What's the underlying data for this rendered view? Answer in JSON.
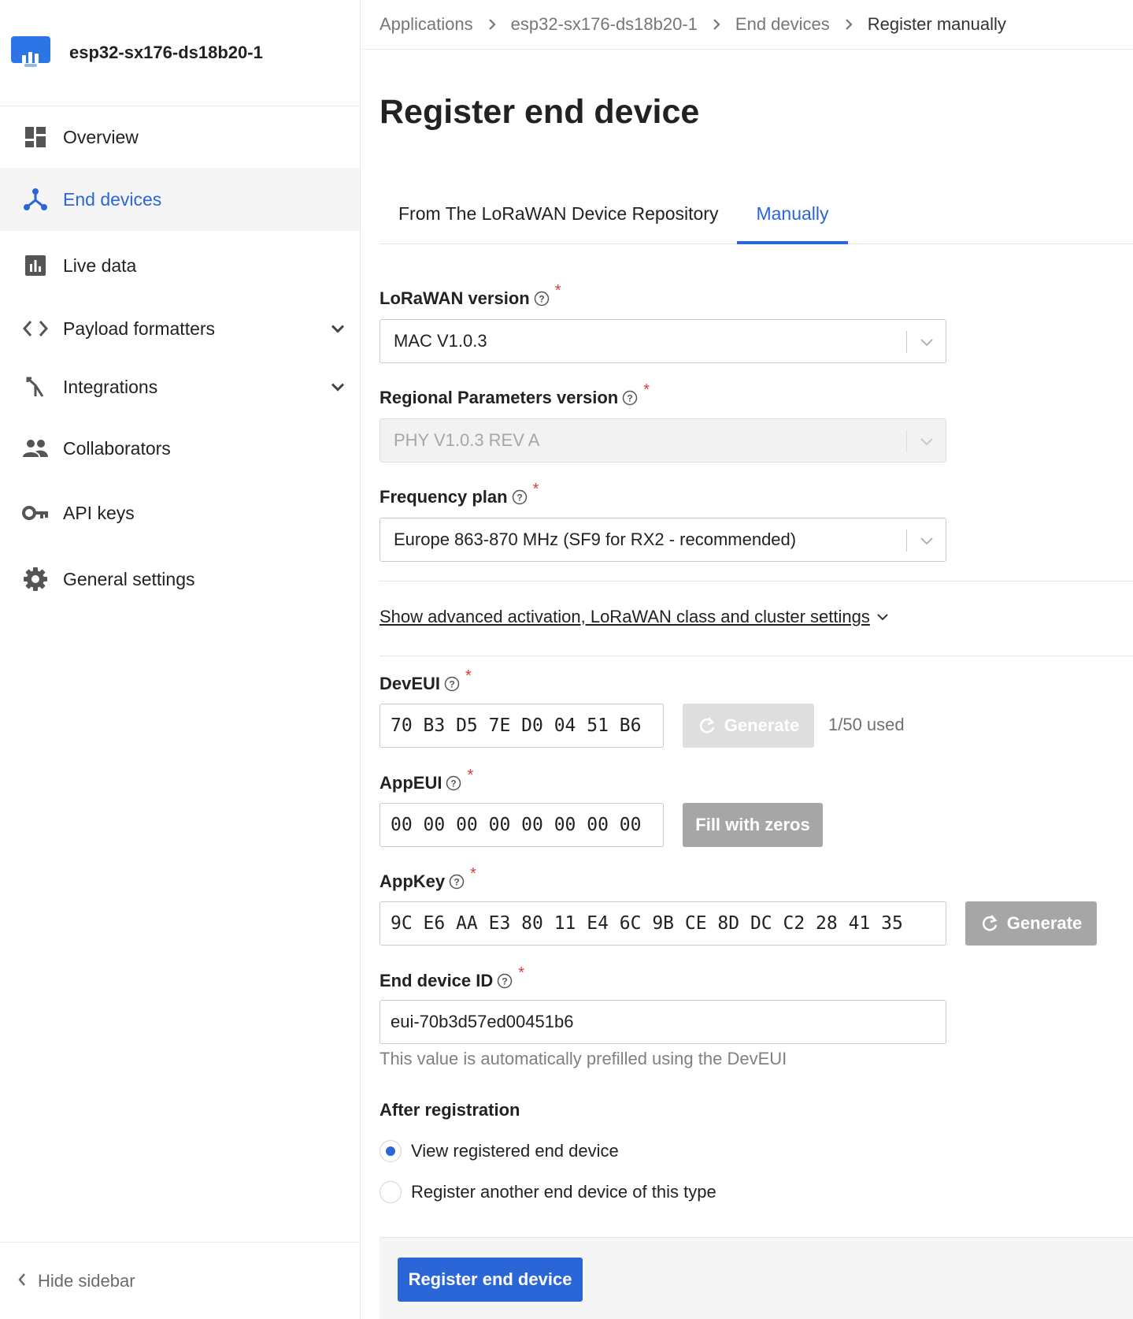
{
  "app": {
    "name": "esp32-sx176-ds18b20-1"
  },
  "sidebar": {
    "items": [
      {
        "label": "Overview",
        "icon": "dashboard-icon"
      },
      {
        "label": "End devices",
        "icon": "end-devices-icon"
      },
      {
        "label": "Live data",
        "icon": "bar-chart-icon"
      },
      {
        "label": "Payload formatters",
        "icon": "code-icon"
      },
      {
        "label": "Integrations",
        "icon": "merge-icon"
      },
      {
        "label": "Collaborators",
        "icon": "people-icon"
      },
      {
        "label": "API keys",
        "icon": "key-icon"
      },
      {
        "label": "General settings",
        "icon": "gear-icon"
      }
    ],
    "hide_label": "Hide sidebar"
  },
  "breadcrumb": [
    "Applications",
    "esp32-sx176-ds18b20-1",
    "End devices",
    "Register manually"
  ],
  "page": {
    "title": "Register end device"
  },
  "tabs": [
    "From The LoRaWAN Device Repository",
    "Manually"
  ],
  "form": {
    "lorawan_version": {
      "label": "LoRaWAN version",
      "value": "MAC V1.0.3"
    },
    "regional_params": {
      "label": "Regional Parameters version",
      "value": "PHY V1.0.3 REV A"
    },
    "frequency_plan": {
      "label": "Frequency plan",
      "value": "Europe 863-870 MHz (SF9 for RX2 - recommended)"
    },
    "advanced_link": "Show advanced activation, LoRaWAN class and cluster settings",
    "dev_eui": {
      "label": "DevEUI",
      "value": "70 B3 D5 7E D0 04 51 B6",
      "generate": "Generate",
      "used": "1/50 used"
    },
    "app_eui": {
      "label": "AppEUI",
      "value": "00 00 00 00 00 00 00 00",
      "fill": "Fill with zeros"
    },
    "app_key": {
      "label": "AppKey",
      "value": "9C E6 AA E3 80 11 E4 6C 9B CE 8D DC C2 28 41 35",
      "generate": "Generate"
    },
    "end_device_id": {
      "label": "End device ID",
      "value": "eui-70b3d57ed00451b6",
      "hint": "This value is automatically prefilled using the DevEUI"
    },
    "after_registration": {
      "label": "After registration",
      "options": [
        "View registered end device",
        "Register another end device of this type"
      ],
      "selected": 0
    },
    "submit": "Register end device"
  },
  "colors": {
    "accent": "#2b66d9",
    "required": "#d93c3c"
  }
}
